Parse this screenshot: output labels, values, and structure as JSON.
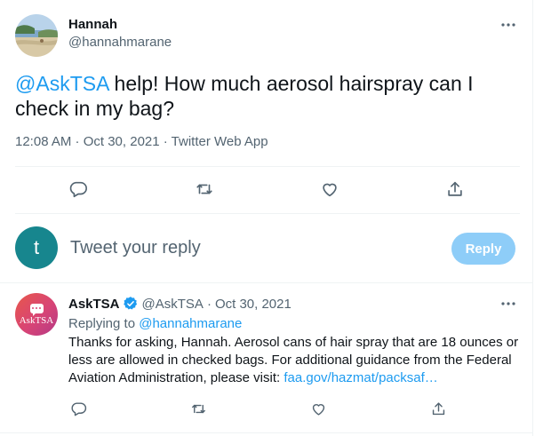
{
  "tweet": {
    "display_name": "Hannah",
    "handle": "@hannahmarane",
    "mention": "@AskTSA",
    "text": " help! How much aerosol hairspray can I check in my bag?",
    "meta": "12:08 AM · Oct 30, 2021 · Twitter Web App"
  },
  "actions": [
    "reply-icon",
    "retweet-icon",
    "like-icon",
    "share-icon"
  ],
  "composer": {
    "avatar_letter": "t",
    "placeholder": "Tweet your reply",
    "button_label": "Reply",
    "button_color": "#8ecdf8"
  },
  "reply": {
    "display_name": "AskTSA",
    "avatar_text": "AskTSA",
    "handle": "@AskTSA",
    "dot": "·",
    "date": "Oct 30, 2021",
    "replying_prefix": "Replying to ",
    "replying_to": "@hannahmarane",
    "text": "Thanks for asking, Hannah. Aerosol cans of hair spray that are 18 ounces or less are allowed in checked bags. For additional guidance from the Federal Aviation Administration, please visit: ",
    "link": "faa.gov/hazmat/packsaf…"
  },
  "colors": {
    "accent": "#1d9bf0",
    "muted": "#536471",
    "text": "#0f1419",
    "composer_avatar": "#17868e"
  }
}
